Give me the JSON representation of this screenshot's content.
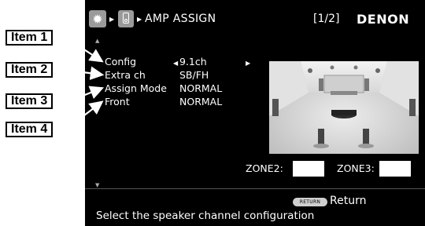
{
  "header": {
    "title": "AMP ASSIGN",
    "page_indicator": "[1/2]",
    "brand": "DENON",
    "icons": [
      "gear-icon",
      "speaker-icon"
    ]
  },
  "settings": [
    {
      "label": "Config",
      "value": "9.1ch"
    },
    {
      "label": "Extra ch",
      "value": "SB/FH"
    },
    {
      "label": "Assign Mode",
      "value": "NORMAL"
    },
    {
      "label": "Front",
      "value": "NORMAL"
    }
  ],
  "zones": {
    "zone2_label": "ZONE2:",
    "zone2_value": "",
    "zone3_label": "ZONE3:",
    "zone3_value": ""
  },
  "footer": {
    "return_button": "RETURN",
    "return_label": "Return",
    "help_text": "Select the speaker channel configuration"
  },
  "callouts": [
    "Item 1",
    "Item 2",
    "Item 3",
    "Item 4"
  ],
  "colors": {
    "screen_bg": "#000000",
    "text": "#ffffff",
    "button_grey": "#9a9a9a"
  }
}
